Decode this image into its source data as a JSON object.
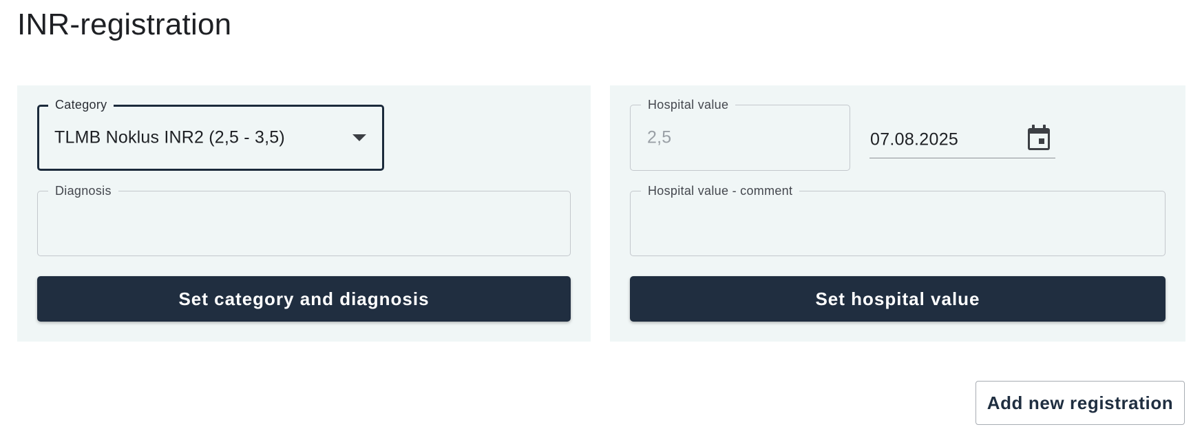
{
  "page": {
    "title": "INR-registration"
  },
  "category_panel": {
    "category": {
      "label": "Category",
      "value": "TLMB Noklus INR2 (2,5 - 3,5)"
    },
    "diagnosis": {
      "label": "Diagnosis",
      "value": ""
    },
    "submit_label": "Set category and diagnosis"
  },
  "hospital_panel": {
    "hospital_value": {
      "label": "Hospital value",
      "placeholder": "2,5",
      "value": ""
    },
    "date": {
      "value": "07.08.2025",
      "icon": "calendar-icon"
    },
    "comment": {
      "label": "Hospital value - comment",
      "value": ""
    },
    "submit_label": "Set hospital value"
  },
  "actions": {
    "add_new_label": "Add new registration"
  },
  "colors": {
    "panel_background": "#f0f6f6",
    "primary_button": "#202e40",
    "focused_border": "#1b2a3b"
  }
}
